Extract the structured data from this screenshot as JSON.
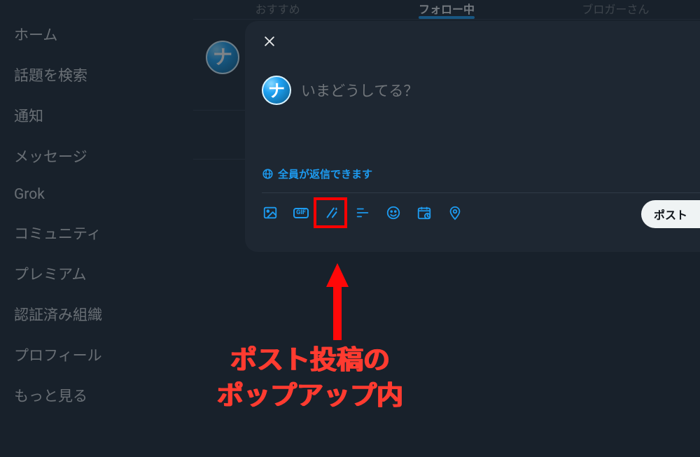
{
  "sidebar": {
    "items": [
      {
        "label": "ホーム"
      },
      {
        "label": "話題を検索"
      },
      {
        "label": "通知"
      },
      {
        "label": "メッセージ"
      },
      {
        "label": "Grok"
      },
      {
        "label": "コミュニティ"
      },
      {
        "label": "プレミアム"
      },
      {
        "label": "認証済み組織"
      },
      {
        "label": "プロフィール"
      },
      {
        "label": "もっと見る"
      }
    ]
  },
  "tabs": {
    "items": [
      {
        "label": "おすすめ",
        "active": false
      },
      {
        "label": "フォロー中",
        "active": true
      },
      {
        "label": "ブロガーさん",
        "active": false
      }
    ]
  },
  "compose": {
    "placeholder": "いまどうしてる？",
    "reply_setting": "全員が返信できます",
    "post_button": "ポスト",
    "gif_label": "GIF"
  },
  "annotation": {
    "line1": "ポスト投稿の",
    "line2": "ポップアップ内"
  },
  "icons": {
    "close": "close-icon",
    "globe": "globe-icon",
    "image": "image-icon",
    "gif": "gif-icon",
    "grok": "grok-icon",
    "poll": "poll-icon",
    "emoji": "emoji-icon",
    "schedule": "schedule-icon",
    "location": "location-icon"
  },
  "colors": {
    "accent": "#1d9bf0",
    "danger": "#ff3b30",
    "bg": "#1e2732"
  }
}
